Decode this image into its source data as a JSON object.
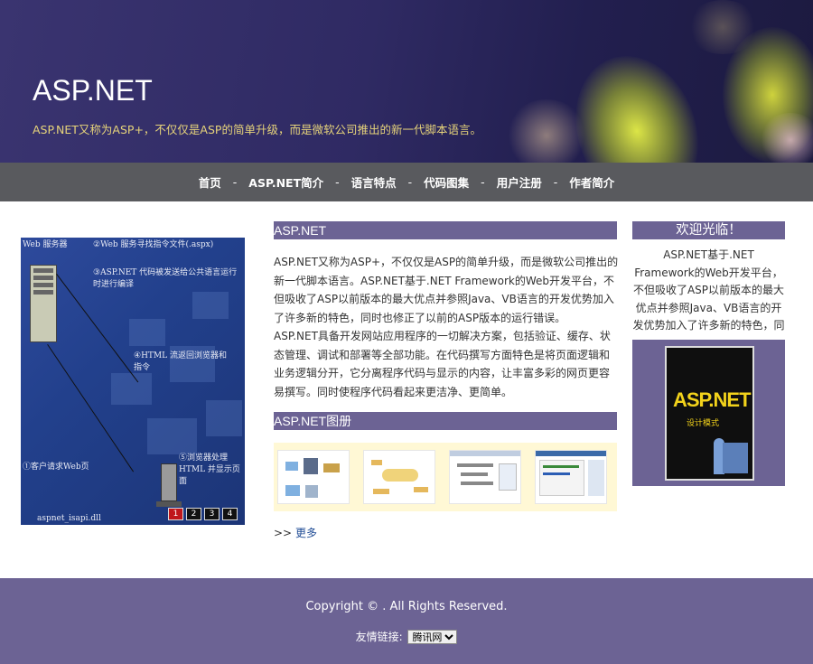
{
  "header": {
    "title": "ASP.NET",
    "subtitle": "ASP.NET又称为ASP+，不仅仅是ASP的简单升级，而是微软公司推出的新一代脚本语言。"
  },
  "nav": {
    "items": [
      "首页",
      "ASP.NET简介",
      "语言特点",
      "代码图集",
      "用户注册",
      "作者简介"
    ],
    "separator": "-"
  },
  "slider": {
    "labels": {
      "web_server": "Web 服务器",
      "step2": "②Web 服务寻找指令文件(.aspx)",
      "step3": "③ASP.NET 代码被发送给公共语言运行时进行编译",
      "step4": "④HTML 流返回浏览器和指令",
      "step1": "①客户请求Web页",
      "step5": "⑤浏览器处理 HTML 并显示页面",
      "dll": "aspnet_isapi.dll"
    },
    "pages": [
      "1",
      "2",
      "3",
      "4"
    ],
    "active_page": "1"
  },
  "main": {
    "section1_title": "ASP.NET",
    "para1": "ASP.NET又称为ASP+，不仅仅是ASP的简单升级，而是微软公司推出的新一代脚本语言。ASP.NET基于.NET Framework的Web开发平台，不但吸收了ASP以前版本的最大优点并参照Java、VB语言的开发优势加入了许多新的特色，同时也修正了以前的ASP版本的运行错误。",
    "para2": "ASP.NET具备开发网站应用程序的一切解决方案，包括验证、缓存、状态管理、调试和部署等全部功能。在代码撰写方面特色是将页面逻辑和业务逻辑分开，它分离程序代码与显示的内容，让丰富多彩的网页更容易撰写。同时使程序代码看起来更洁净、更简单。",
    "section2_title": "ASP.NET图册",
    "more_prefix": ">>",
    "more_label": "更多"
  },
  "sidebar": {
    "welcome_title": "欢迎光临！",
    "welcome_text": "ASP.NET基于.NET Framework的Web开发平台，不但吸收了ASP以前版本的最大优点并参照Java、VB语言的开发优势加入了许多新的特色，同时也修正了",
    "book_title": "ASP.NET",
    "book_subtitle": "设计模式"
  },
  "footer": {
    "copyright": "Copyright © . All Rights Reserved.",
    "links_label": "友情链接:",
    "links_selected": "腾讯网"
  },
  "colors": {
    "section_bar": "#6c6394",
    "nav_bg": "#595a5e",
    "subtitle": "#e6d37a",
    "pager_active": "#c0171b"
  }
}
